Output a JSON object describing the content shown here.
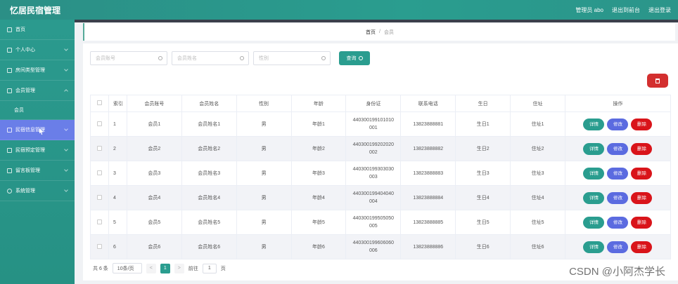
{
  "app": {
    "title": "忆居民宿管理"
  },
  "topbar": {
    "admin": "管理员 abo",
    "back_front": "退出到前台",
    "logout": "退出登录"
  },
  "sidebar": {
    "items": [
      {
        "label": "首页",
        "icon": "home-icon"
      },
      {
        "label": "个人中心",
        "icon": "user-icon"
      },
      {
        "label": "房间类型管理",
        "icon": "send-icon"
      },
      {
        "label": "会员管理",
        "icon": "folder-icon"
      },
      {
        "label": "会员"
      },
      {
        "label": "民宿信息管理",
        "icon": "doc-icon"
      },
      {
        "label": "民宿预定管理",
        "icon": "grid-icon"
      },
      {
        "label": "留言板管理",
        "icon": "message-icon"
      },
      {
        "label": "系统管理",
        "icon": "gear-icon"
      }
    ]
  },
  "breadcrumb": {
    "home": "首页",
    "sep": "/",
    "current": "会员"
  },
  "search": {
    "account_placeholder": "会员账号",
    "name_placeholder": "会员姓名",
    "gender_placeholder": "性别",
    "button": "查询"
  },
  "table": {
    "headers": [
      "索引",
      "会员账号",
      "会员姓名",
      "性别",
      "年龄",
      "身份证",
      "联系电话",
      "生日",
      "住址",
      "操作"
    ],
    "rows": [
      {
        "index": "1",
        "account": "会员1",
        "name": "会员姓名1",
        "gender": "男",
        "age": "年龄1",
        "id1": "440300199101010",
        "id2": "001",
        "phone": "13823888881",
        "birthday": "生日1",
        "address": "住址1"
      },
      {
        "index": "2",
        "account": "会员2",
        "name": "会员姓名2",
        "gender": "男",
        "age": "年龄2",
        "id1": "440300199202020",
        "id2": "002",
        "phone": "13823888882",
        "birthday": "生日2",
        "address": "住址2"
      },
      {
        "index": "3",
        "account": "会员3",
        "name": "会员姓名3",
        "gender": "男",
        "age": "年龄3",
        "id1": "440300199303030",
        "id2": "003",
        "phone": "13823888883",
        "birthday": "生日3",
        "address": "住址3"
      },
      {
        "index": "4",
        "account": "会员4",
        "name": "会员姓名4",
        "gender": "男",
        "age": "年龄4",
        "id1": "440300199404040",
        "id2": "004",
        "phone": "13823888884",
        "birthday": "生日4",
        "address": "住址4"
      },
      {
        "index": "5",
        "account": "会员5",
        "name": "会员姓名5",
        "gender": "男",
        "age": "年龄5",
        "id1": "440300199505050",
        "id2": "005",
        "phone": "13823888885",
        "birthday": "生日5",
        "address": "住址5"
      },
      {
        "index": "6",
        "account": "会员6",
        "name": "会员姓名6",
        "gender": "男",
        "age": "年龄6",
        "id1": "440300199606060",
        "id2": "006",
        "phone": "13823888886",
        "birthday": "生日6",
        "address": "住址6"
      }
    ],
    "actions": {
      "detail": "详情",
      "edit": "修改",
      "delete": "删除"
    }
  },
  "pager": {
    "total": "共 6 条",
    "size": "10条/页",
    "prev": "<",
    "page": "1",
    "next": ">",
    "goto": "前往",
    "goto_value": "1",
    "page_unit": "页"
  },
  "watermark": "CSDN @小阿杰学长",
  "colors": {
    "primary": "#2a9d8f",
    "edit": "#5b6be0",
    "danger": "#d9141a",
    "active_menu": "#6a7ee8"
  }
}
